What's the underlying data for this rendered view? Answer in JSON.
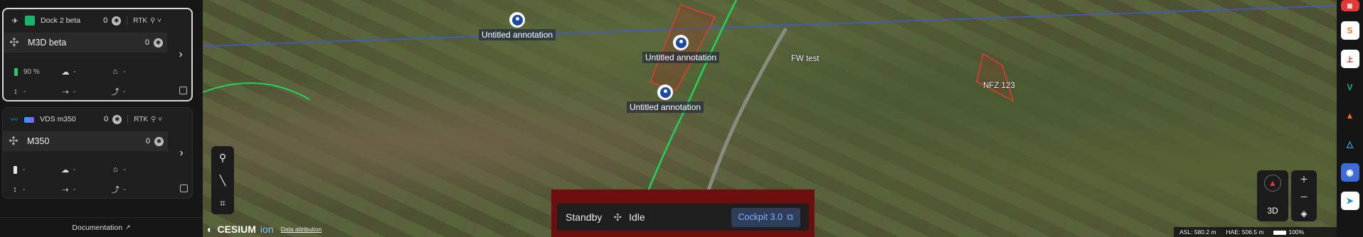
{
  "sidebar": {
    "cards": [
      {
        "dock_name": "Dock 2 beta",
        "dock_count": "0",
        "rtk": "RTK",
        "drone_name": "M3D beta",
        "drone_count": "0",
        "battery": "90 %",
        "weather_value": "-",
        "home_value": "-",
        "alt_value": "-",
        "speed_value": "-",
        "hspeed_value": "-"
      },
      {
        "dock_name": "VDS m350",
        "dock_count": "0",
        "rtk": "RTK",
        "drone_name": "M350",
        "drone_count": "0",
        "battery": "-",
        "weather_value": "-",
        "home_value": "-",
        "alt_value": "-",
        "speed_value": "-",
        "hspeed_value": "-"
      }
    ],
    "documentation_label": "Documentation"
  },
  "map": {
    "annotations": [
      {
        "label": "Untitled annotation"
      },
      {
        "label": "Untitled annotation"
      },
      {
        "label": "Untitled annotation"
      }
    ],
    "areas": [
      {
        "label": "FW test",
        "color": "#e53935"
      },
      {
        "label": "NFZ 123",
        "color": "#e53935"
      }
    ],
    "status": {
      "mode": "Standby",
      "state": "Idle",
      "cockpit_label": "Cockpit 3.0"
    },
    "branding": {
      "cesium": "CESIUM",
      "ion": "ion",
      "attribution": "Data attribution"
    },
    "controls": {
      "view_mode": "3D"
    },
    "info": {
      "asl_label": "ASL:",
      "asl_value": "580.2 m",
      "hae_label": "HAE:",
      "hae_value": "506.5 m",
      "zoom": "100%"
    }
  },
  "colors": {
    "status_frame": "#6b0f0f",
    "battery_ok": "#2cc36b",
    "cockpit_text": "#7fb2ff",
    "route_line": "#3d5bd8",
    "road_line": "#22d35a"
  },
  "rail_apps": [
    {
      "icon": "red-app-icon",
      "color": "#e53935"
    },
    {
      "icon": "orange-s-app-icon",
      "color": "#ff7a1a"
    },
    {
      "icon": "red-text-app-icon",
      "color": "#c62828"
    },
    {
      "icon": "green-v-app-icon",
      "color": "#19b36b"
    },
    {
      "icon": "orange-triangle-app-icon",
      "color": "#ff6f00"
    },
    {
      "icon": "blue-triangle-app-icon",
      "color": "#29b6f6"
    },
    {
      "icon": "blue-map-app-icon",
      "color": "#3f6bd8"
    },
    {
      "icon": "white-send-app-icon",
      "color": "#ffffff"
    }
  ]
}
